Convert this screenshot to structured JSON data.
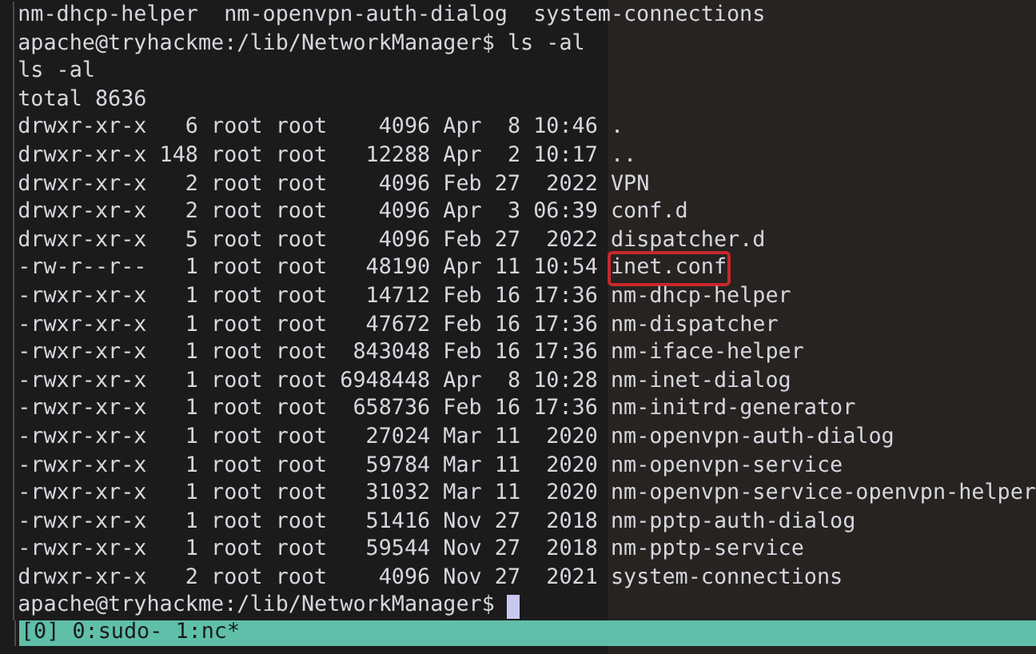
{
  "lines": [
    {
      "kind": "output",
      "text": "nm-dhcp-helper  nm-openvpn-auth-dialog  system-connections"
    },
    {
      "kind": "command",
      "prompt": "apache@tryhackme:/lib/NetworkManager$",
      "text": "ls -al"
    },
    {
      "kind": "output",
      "text": "ls -al"
    },
    {
      "kind": "output",
      "text": "total 8636"
    },
    {
      "kind": "entry",
      "info": "drwxr-xr-x   6 root root    4096 Apr  8 10:46",
      "name": ".",
      "highlighted": false
    },
    {
      "kind": "entry",
      "info": "drwxr-xr-x 148 root root   12288 Apr  2 10:17",
      "name": "..",
      "highlighted": false
    },
    {
      "kind": "entry",
      "info": "drwxr-xr-x   2 root root    4096 Feb 27  2022",
      "name": "VPN",
      "highlighted": false
    },
    {
      "kind": "entry",
      "info": "drwxr-xr-x   2 root root    4096 Apr  3 06:39",
      "name": "conf.d",
      "highlighted": false
    },
    {
      "kind": "entry",
      "info": "drwxr-xr-x   5 root root    4096 Feb 27  2022",
      "name": "dispatcher.d",
      "highlighted": false
    },
    {
      "kind": "entry",
      "info": "-rw-r--r--   1 root root   48190 Apr 11 10:54",
      "name": "inet.conf",
      "highlighted": true
    },
    {
      "kind": "entry",
      "info": "-rwxr-xr-x   1 root root   14712 Feb 16 17:36",
      "name": "nm-dhcp-helper",
      "highlighted": false
    },
    {
      "kind": "entry",
      "info": "-rwxr-xr-x   1 root root   47672 Feb 16 17:36",
      "name": "nm-dispatcher",
      "highlighted": false
    },
    {
      "kind": "entry",
      "info": "-rwxr-xr-x   1 root root  843048 Feb 16 17:36",
      "name": "nm-iface-helper",
      "highlighted": false
    },
    {
      "kind": "entry",
      "info": "-rwxr-xr-x   1 root root 6948448 Apr  8 10:28",
      "name": "nm-inet-dialog",
      "highlighted": false
    },
    {
      "kind": "entry",
      "info": "-rwxr-xr-x   1 root root  658736 Feb 16 17:36",
      "name": "nm-initrd-generator",
      "highlighted": false
    },
    {
      "kind": "entry",
      "info": "-rwxr-xr-x   1 root root   27024 Mar 11  2020",
      "name": "nm-openvpn-auth-dialog",
      "highlighted": false
    },
    {
      "kind": "entry",
      "info": "-rwxr-xr-x   1 root root   59784 Mar 11  2020",
      "name": "nm-openvpn-service",
      "highlighted": false
    },
    {
      "kind": "entry",
      "info": "-rwxr-xr-x   1 root root   31032 Mar 11  2020",
      "name": "nm-openvpn-service-openvpn-helper",
      "highlighted": false
    },
    {
      "kind": "entry",
      "info": "-rwxr-xr-x   1 root root   51416 Nov 27  2018",
      "name": "nm-pptp-auth-dialog",
      "highlighted": false
    },
    {
      "kind": "entry",
      "info": "-rwxr-xr-x   1 root root   59544 Nov 27  2018",
      "name": "nm-pptp-service",
      "highlighted": false
    },
    {
      "kind": "entry",
      "info": "drwxr-xr-x   2 root root    4096 Nov 27  2021",
      "name": "system-connections",
      "highlighted": false
    },
    {
      "kind": "prompt",
      "prompt": "apache@tryhackme:/lib/NetworkManager$",
      "cursor": true
    }
  ],
  "status_bar": {
    "text": "[0] 0:sudo- 1:nc*"
  }
}
